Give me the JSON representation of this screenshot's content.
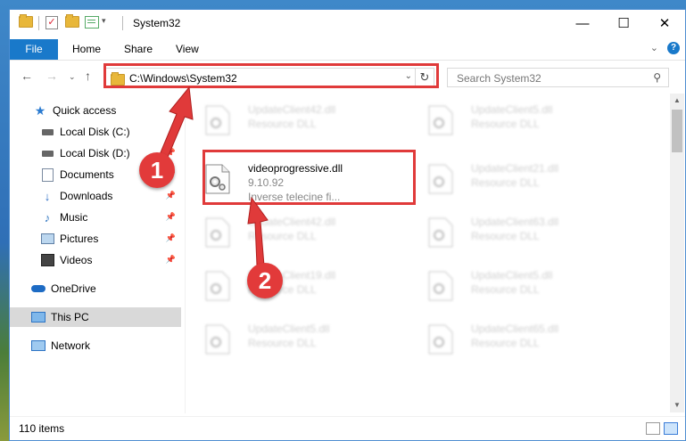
{
  "window": {
    "title": "System32",
    "controls": {
      "minimize": "—",
      "maximize": "☐",
      "close": "✕"
    }
  },
  "ribbon": {
    "file": "File",
    "tabs": [
      "Home",
      "Share",
      "View"
    ],
    "help": "?"
  },
  "nav": {
    "address": "C:\\Windows\\System32",
    "search_placeholder": "Search System32"
  },
  "sidebar": {
    "items": [
      {
        "label": "Quick access",
        "icon": "star-icon"
      },
      {
        "label": "Local Disk (C:)",
        "icon": "drive-icon"
      },
      {
        "label": "Local Disk (D:)",
        "icon": "drive-icon"
      },
      {
        "label": "Documents",
        "icon": "documents-icon"
      },
      {
        "label": "Downloads",
        "icon": "downloads-icon"
      },
      {
        "label": "Music",
        "icon": "music-icon"
      },
      {
        "label": "Pictures",
        "icon": "pictures-icon"
      },
      {
        "label": "Videos",
        "icon": "videos-icon"
      },
      {
        "label": "OneDrive",
        "icon": "onedrive-icon"
      },
      {
        "label": "This PC",
        "icon": "this-pc-icon",
        "selected": true
      },
      {
        "label": "Network",
        "icon": "network-icon"
      }
    ]
  },
  "files": {
    "focused": {
      "name": "videoprogressive.dll",
      "version": "9.10.92",
      "description": "Inverse telecine fi..."
    },
    "blurred": [
      {
        "name": "UpdateClient42.dll",
        "type": "Resource DLL"
      },
      {
        "name": "UpdateClient5.dll",
        "type": "Resource DLL"
      },
      {
        "name": "UpdateClient21.dll",
        "type": "Resource DLL"
      },
      {
        "name": "UpdateClient42.dll",
        "type": "Resource DLL"
      },
      {
        "name": "UpdateClient63.dll",
        "type": "Resource DLL"
      },
      {
        "name": "UpdateClient19.dll",
        "type": "Resource DLL"
      },
      {
        "name": "UpdateClient5.dll",
        "type": "Resource DLL"
      },
      {
        "name": "UpdateClient5.dll",
        "type": "Resource DLL"
      },
      {
        "name": "UpdateClient65.dll",
        "type": "Resource DLL"
      }
    ]
  },
  "status": {
    "item_count": "110 items"
  },
  "annotations": {
    "step1": "1",
    "step2": "2",
    "color": "#e03a3a"
  }
}
